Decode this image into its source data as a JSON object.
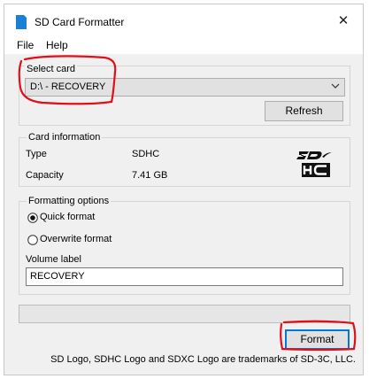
{
  "window": {
    "title": "SD Card Formatter",
    "close_symbol": "✕"
  },
  "menu": {
    "items": [
      "File",
      "Help"
    ]
  },
  "select_card": {
    "group_title": "Select card",
    "selected_value": "D:\\ - RECOVERY",
    "refresh_label": "Refresh"
  },
  "card_info": {
    "group_title": "Card information",
    "type_label": "Type",
    "type_value": "SDHC",
    "capacity_label": "Capacity",
    "capacity_value": "7.41 GB"
  },
  "formatting": {
    "group_title": "Formatting options",
    "quick_format_label": "Quick format",
    "quick_format_selected": true,
    "overwrite_format_label": "Overwrite format",
    "volume_label_caption": "Volume label",
    "volume_label_value": "RECOVERY"
  },
  "progress": {
    "value": 0
  },
  "format_label": "Format",
  "footer_text": "SD Logo, SDHC Logo and SDXC Logo are trademarks of SD-3C, LLC.",
  "colors": {
    "annotation_red": "#e0101a",
    "focus_blue": "#0078d7",
    "app_icon_blue": "#1a7fd6"
  },
  "icons": [
    "sd-app-icon",
    "close-icon",
    "chevron-down-icon",
    "sdhc-logo"
  ]
}
